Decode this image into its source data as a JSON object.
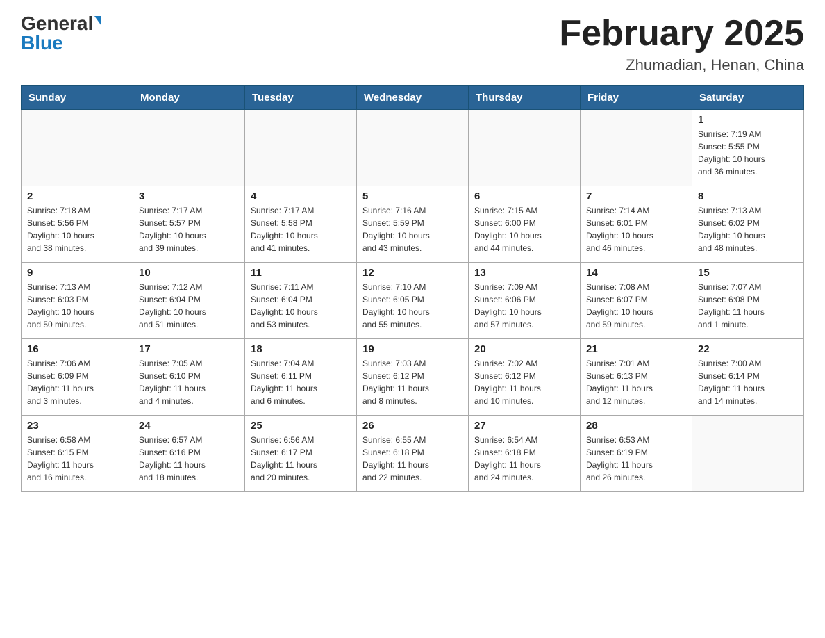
{
  "header": {
    "logo_general": "General",
    "logo_blue": "Blue",
    "month_title": "February 2025",
    "location": "Zhumadian, Henan, China"
  },
  "weekdays": [
    "Sunday",
    "Monday",
    "Tuesday",
    "Wednesday",
    "Thursday",
    "Friday",
    "Saturday"
  ],
  "weeks": [
    [
      {
        "day": "",
        "info": ""
      },
      {
        "day": "",
        "info": ""
      },
      {
        "day": "",
        "info": ""
      },
      {
        "day": "",
        "info": ""
      },
      {
        "day": "",
        "info": ""
      },
      {
        "day": "",
        "info": ""
      },
      {
        "day": "1",
        "info": "Sunrise: 7:19 AM\nSunset: 5:55 PM\nDaylight: 10 hours\nand 36 minutes."
      }
    ],
    [
      {
        "day": "2",
        "info": "Sunrise: 7:18 AM\nSunset: 5:56 PM\nDaylight: 10 hours\nand 38 minutes."
      },
      {
        "day": "3",
        "info": "Sunrise: 7:17 AM\nSunset: 5:57 PM\nDaylight: 10 hours\nand 39 minutes."
      },
      {
        "day": "4",
        "info": "Sunrise: 7:17 AM\nSunset: 5:58 PM\nDaylight: 10 hours\nand 41 minutes."
      },
      {
        "day": "5",
        "info": "Sunrise: 7:16 AM\nSunset: 5:59 PM\nDaylight: 10 hours\nand 43 minutes."
      },
      {
        "day": "6",
        "info": "Sunrise: 7:15 AM\nSunset: 6:00 PM\nDaylight: 10 hours\nand 44 minutes."
      },
      {
        "day": "7",
        "info": "Sunrise: 7:14 AM\nSunset: 6:01 PM\nDaylight: 10 hours\nand 46 minutes."
      },
      {
        "day": "8",
        "info": "Sunrise: 7:13 AM\nSunset: 6:02 PM\nDaylight: 10 hours\nand 48 minutes."
      }
    ],
    [
      {
        "day": "9",
        "info": "Sunrise: 7:13 AM\nSunset: 6:03 PM\nDaylight: 10 hours\nand 50 minutes."
      },
      {
        "day": "10",
        "info": "Sunrise: 7:12 AM\nSunset: 6:04 PM\nDaylight: 10 hours\nand 51 minutes."
      },
      {
        "day": "11",
        "info": "Sunrise: 7:11 AM\nSunset: 6:04 PM\nDaylight: 10 hours\nand 53 minutes."
      },
      {
        "day": "12",
        "info": "Sunrise: 7:10 AM\nSunset: 6:05 PM\nDaylight: 10 hours\nand 55 minutes."
      },
      {
        "day": "13",
        "info": "Sunrise: 7:09 AM\nSunset: 6:06 PM\nDaylight: 10 hours\nand 57 minutes."
      },
      {
        "day": "14",
        "info": "Sunrise: 7:08 AM\nSunset: 6:07 PM\nDaylight: 10 hours\nand 59 minutes."
      },
      {
        "day": "15",
        "info": "Sunrise: 7:07 AM\nSunset: 6:08 PM\nDaylight: 11 hours\nand 1 minute."
      }
    ],
    [
      {
        "day": "16",
        "info": "Sunrise: 7:06 AM\nSunset: 6:09 PM\nDaylight: 11 hours\nand 3 minutes."
      },
      {
        "day": "17",
        "info": "Sunrise: 7:05 AM\nSunset: 6:10 PM\nDaylight: 11 hours\nand 4 minutes."
      },
      {
        "day": "18",
        "info": "Sunrise: 7:04 AM\nSunset: 6:11 PM\nDaylight: 11 hours\nand 6 minutes."
      },
      {
        "day": "19",
        "info": "Sunrise: 7:03 AM\nSunset: 6:12 PM\nDaylight: 11 hours\nand 8 minutes."
      },
      {
        "day": "20",
        "info": "Sunrise: 7:02 AM\nSunset: 6:12 PM\nDaylight: 11 hours\nand 10 minutes."
      },
      {
        "day": "21",
        "info": "Sunrise: 7:01 AM\nSunset: 6:13 PM\nDaylight: 11 hours\nand 12 minutes."
      },
      {
        "day": "22",
        "info": "Sunrise: 7:00 AM\nSunset: 6:14 PM\nDaylight: 11 hours\nand 14 minutes."
      }
    ],
    [
      {
        "day": "23",
        "info": "Sunrise: 6:58 AM\nSunset: 6:15 PM\nDaylight: 11 hours\nand 16 minutes."
      },
      {
        "day": "24",
        "info": "Sunrise: 6:57 AM\nSunset: 6:16 PM\nDaylight: 11 hours\nand 18 minutes."
      },
      {
        "day": "25",
        "info": "Sunrise: 6:56 AM\nSunset: 6:17 PM\nDaylight: 11 hours\nand 20 minutes."
      },
      {
        "day": "26",
        "info": "Sunrise: 6:55 AM\nSunset: 6:18 PM\nDaylight: 11 hours\nand 22 minutes."
      },
      {
        "day": "27",
        "info": "Sunrise: 6:54 AM\nSunset: 6:18 PM\nDaylight: 11 hours\nand 24 minutes."
      },
      {
        "day": "28",
        "info": "Sunrise: 6:53 AM\nSunset: 6:19 PM\nDaylight: 11 hours\nand 26 minutes."
      },
      {
        "day": "",
        "info": ""
      }
    ]
  ]
}
